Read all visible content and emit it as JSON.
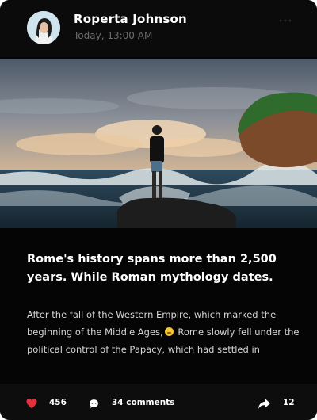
{
  "post": {
    "author": "Roperta Johnson",
    "timestamp": "Today, 13:00 AM",
    "title": "Rome's history spans more than 2,500 years. While Roman mythology dates.",
    "body_part1": "After the fall of the Western Empire, which marked the beginning of the Middle Ages,",
    "body_part2": " Rome slowly fell under the political control of the Papacy, which had settled in",
    "likes": "456",
    "comments": "34 comments",
    "shares": "12"
  },
  "colors": {
    "like": "#e0313d",
    "card": "#050505",
    "text": "#ffffff"
  },
  "icons": [
    "heart-icon",
    "comment-icon",
    "share-icon",
    "more-icon"
  ]
}
